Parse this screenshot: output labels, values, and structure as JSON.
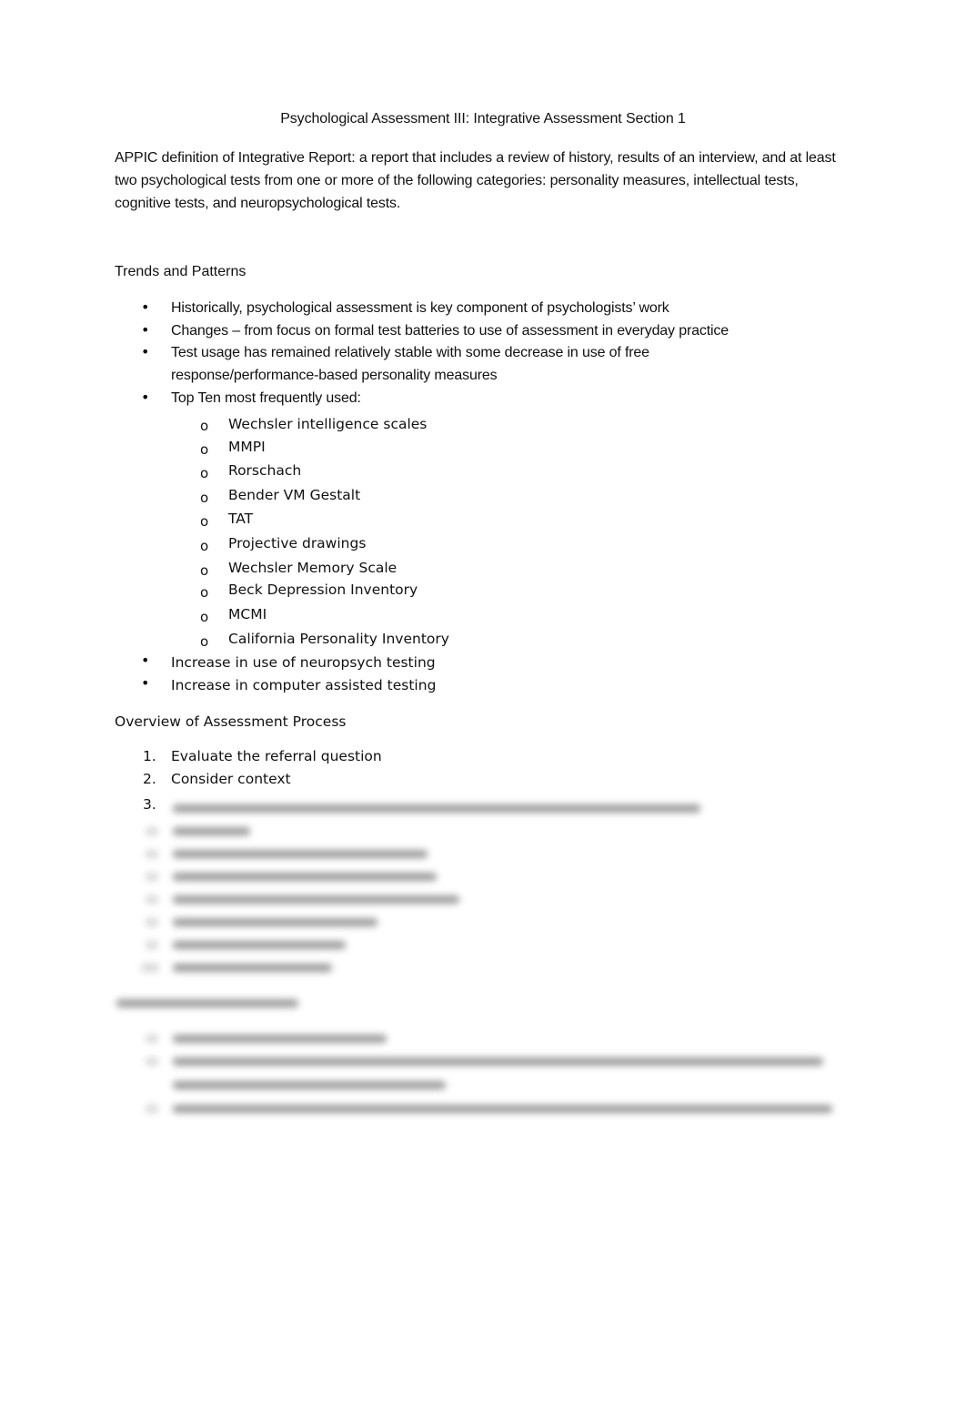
{
  "document": {
    "title": "Psychological Assessment III: Integrative Assessment Section 1",
    "intro": "APPIC definition of Integrative Report: a report that includes a review of history, results of an interview, and at least two psychological tests from one or more of the following categories: personality measures, intellectual tests, cognitive tests, and neuropsychological tests.",
    "trends": {
      "heading": "Trends and Patterns",
      "bullet_glyph": "•",
      "sub_bullet_glyph": "o",
      "items": [
        "Historically, psychological assessment is key component of psychologists’ work",
        "Changes – from focus on formal test batteries to use of assessment in everyday practice",
        "Test usage has remained relatively stable with some decrease in use of free",
        "response/performance-based personality measures",
        "Top Ten most frequently used:"
      ],
      "top_ten": [
        "Wechsler intelligence scales",
        "MMPI",
        "Rorschach",
        "Bender VM Gestalt",
        "TAT",
        "Projective drawings",
        "Wechsler Memory Scale",
        "Beck Depression Inventory",
        "MCMI",
        "California Personality Inventory"
      ],
      "after_items": [
        "Increase in use of neuropsych testing",
        "Increase in computer assisted testing"
      ]
    },
    "overview": {
      "heading": "Overview of Assessment Process",
      "numbers": [
        "1.",
        "2.",
        "3."
      ],
      "items": [
        "Evaluate the referral question",
        "Consider context"
      ]
    }
  }
}
